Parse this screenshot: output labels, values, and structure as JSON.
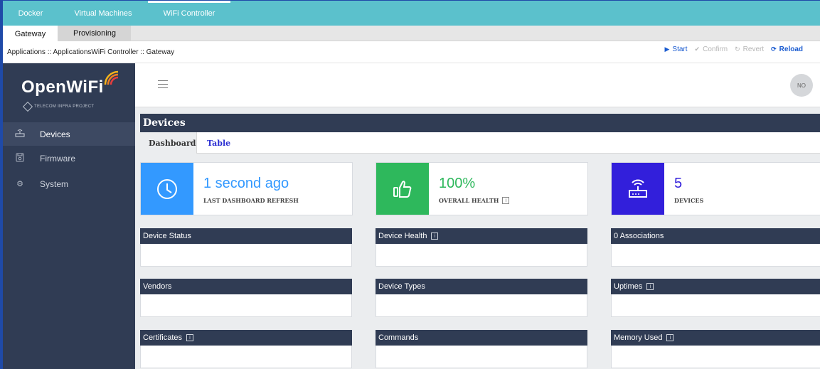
{
  "top_tabs": [
    {
      "label": "Docker"
    },
    {
      "label": "Virtual Machines"
    },
    {
      "label": "WiFi Controller"
    }
  ],
  "sub_tabs": [
    {
      "label": "Gateway"
    },
    {
      "label": "Provisioning"
    }
  ],
  "breadcrumb": "Applications :: ApplicationsWiFi Controller :: Gateway",
  "actions": {
    "start": "Start",
    "confirm": "Confirm",
    "revert": "Revert",
    "reload": "Reload"
  },
  "sidebar": {
    "logo_text": "OpenWiFi",
    "logo_subtitle": "TELECOM INFRA PROJECT",
    "items": [
      {
        "label": "Devices",
        "icon": "router-icon"
      },
      {
        "label": "Firmware",
        "icon": "save-icon"
      },
      {
        "label": "System",
        "icon": "gear-icon"
      }
    ]
  },
  "header": {
    "avatar": "NO"
  },
  "devices": {
    "title": "Devices",
    "tabs": [
      {
        "label": "Dashboard"
      },
      {
        "label": "Table"
      }
    ]
  },
  "stats": [
    {
      "value": "1 second ago",
      "label": "LAST DASHBOARD REFRESH",
      "icon": "clock-icon",
      "color": "#3399ff"
    },
    {
      "value": "100%",
      "label": "OVERALL HEALTH",
      "icon": "thumbs-up-icon",
      "color": "#2eb85c"
    },
    {
      "value": "5",
      "label": "DEVICES",
      "icon": "router-icon",
      "color": "#321fdb"
    }
  ],
  "panels": [
    {
      "title": "Device Status"
    },
    {
      "title": "Device Health"
    },
    {
      "title": "0 Associations"
    },
    {
      "title": "Vendors"
    },
    {
      "title": "Device Types"
    },
    {
      "title": "Uptimes"
    },
    {
      "title": "Certificates"
    },
    {
      "title": "Commands"
    },
    {
      "title": "Memory Used"
    }
  ],
  "colors": {
    "topbar": "#5bc1cc",
    "sidebar": "#303c54",
    "link": "#1a5bd0"
  }
}
